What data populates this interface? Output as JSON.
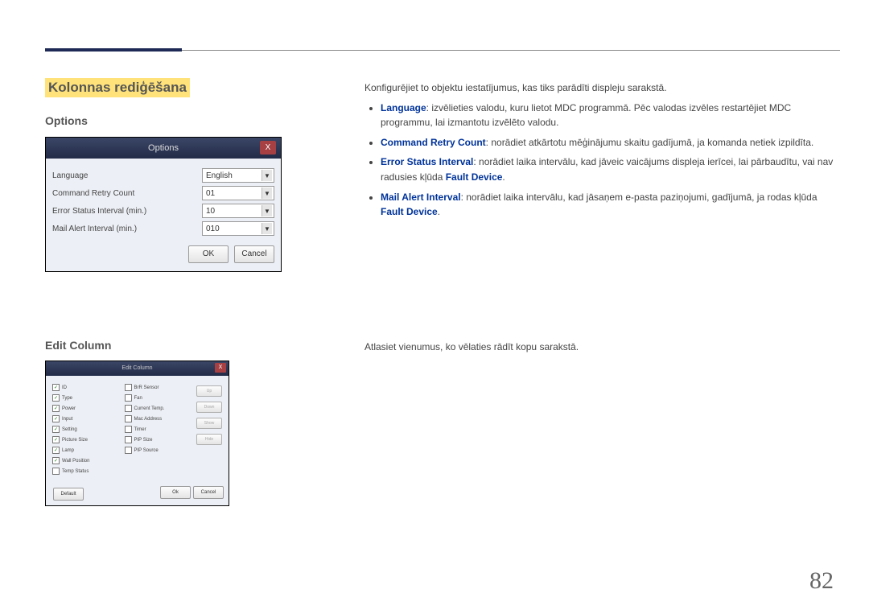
{
  "page": {
    "number": "82"
  },
  "section": {
    "title": "Kolonnas rediģēšana"
  },
  "options": {
    "heading": "Options",
    "intro": "Konfigurējiet to objektu iestatījumus, kas tiks parādīti displeju sarakstā.",
    "bullets": {
      "language": {
        "term": "Language",
        "text": ": izvēlieties valodu, kuru lietot MDC programmā. Pēc valodas izvēles restartējiet MDC programmu, lai izmantotu izvēlēto valodu."
      },
      "crc": {
        "term": "Command Retry Count",
        "text": ": norādiet atkārtotu mēģinājumu skaitu gadījumā, ja komanda netiek izpildīta."
      },
      "esi": {
        "term": "Error Status Interval",
        "text_part1": ": norādiet laika intervālu, kad jāveic vaicājums displeja ierīcei, lai pārbaudītu, vai nav radusies kļūda ",
        "fault": "Fault Device",
        "text_part2": "."
      },
      "mai": {
        "term": "Mail Alert Interval",
        "text_part1": ": norādiet laika intervālu, kad jāsaņem e-pasta paziņojumi, gadījumā, ja rodas kļūda ",
        "fault": "Fault Device",
        "text_part2": "."
      }
    },
    "dialog": {
      "title": "Options",
      "close": "X",
      "rows": {
        "language": {
          "label": "Language",
          "value": "English"
        },
        "crc": {
          "label": "Command Retry Count",
          "value": "01"
        },
        "esi": {
          "label": "Error Status Interval (min.)",
          "value": "10"
        },
        "mai": {
          "label": "Mail Alert Interval (min.)",
          "value": "010"
        }
      },
      "buttons": {
        "ok": "OK",
        "cancel": "Cancel"
      }
    }
  },
  "editcolumn": {
    "heading": "Edit Column",
    "intro": "Atlasiet vienumus, ko vēlaties rādīt kopu sarakstā.",
    "dialog": {
      "title": "Edit Column",
      "close": "X",
      "col1": [
        {
          "label": "ID",
          "checked": true
        },
        {
          "label": "Type",
          "checked": true
        },
        {
          "label": "Power",
          "checked": true
        },
        {
          "label": "Input",
          "checked": true
        },
        {
          "label": "Setting",
          "checked": true
        },
        {
          "label": "Picture Size",
          "checked": true
        },
        {
          "label": "Lamp",
          "checked": true
        },
        {
          "label": "Wall Position",
          "checked": true
        },
        {
          "label": "Temp Status",
          "checked": false
        }
      ],
      "col2": [
        {
          "label": "BrR Sensor",
          "checked": false
        },
        {
          "label": "Fan",
          "checked": false
        },
        {
          "label": "Current Temp.",
          "checked": false
        },
        {
          "label": "Mac Address",
          "checked": false
        },
        {
          "label": "Timer",
          "checked": false
        },
        {
          "label": "PIP Size",
          "checked": false
        },
        {
          "label": "PIP Source",
          "checked": false
        }
      ],
      "side": {
        "up": "Up",
        "down": "Down",
        "show": "Show",
        "hide": "Hide"
      },
      "footer": {
        "default": "Default",
        "ok": "Ok",
        "cancel": "Cancel"
      }
    }
  }
}
